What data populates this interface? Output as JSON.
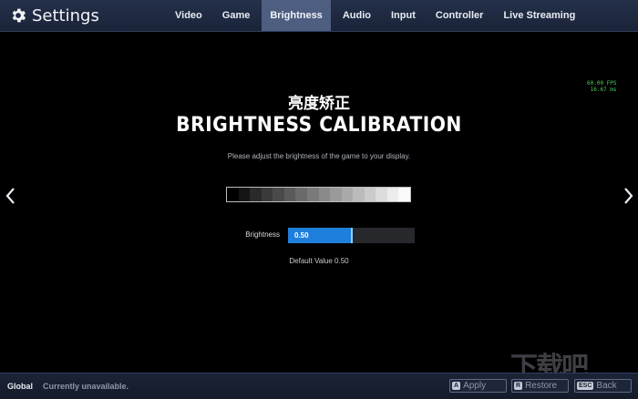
{
  "header": {
    "title": "Settings",
    "tabs": [
      {
        "label": "Video",
        "active": false
      },
      {
        "label": "Game",
        "active": false
      },
      {
        "label": "Brightness",
        "active": true
      },
      {
        "label": "Audio",
        "active": false
      },
      {
        "label": "Input",
        "active": false
      },
      {
        "label": "Controller",
        "active": false
      },
      {
        "label": "Live Streaming",
        "active": false
      }
    ]
  },
  "overlay": {
    "fps": "60.00 FPS",
    "frame_time": "16.67 ms"
  },
  "main": {
    "heading_cn": "亮度矫正",
    "heading_en": "BRIGHTNESS CALIBRATION",
    "instruction": "Please adjust the brightness of the game to your display.",
    "gradient_swatches": [
      "#000000",
      "#151515",
      "#2a2a2a",
      "#3a3a3a",
      "#4a4a4a",
      "#5a5a5a",
      "#6a6a6a",
      "#7a7a7a",
      "#8a8a8a",
      "#9a9a9a",
      "#aaaaaa",
      "#bbbbbb",
      "#cbcbcb",
      "#dcdcdc",
      "#ececec",
      "#fafafa"
    ],
    "brightness": {
      "label": "Brightness",
      "value_text": "0.50",
      "value": 0.5
    },
    "default_value": "Default Value 0.50"
  },
  "watermark": "下载吧",
  "footer": {
    "global_label": "Global",
    "status": "Currently unavailable.",
    "apply": {
      "key": "A",
      "label": "Apply"
    },
    "restore": {
      "key": "R",
      "label": "Restore"
    },
    "back": {
      "key": "ESC",
      "label": "Back"
    }
  },
  "colors": {
    "accent": "#1f7fdc",
    "header_bg": "#1e2840",
    "fps_text": "#4cd15a"
  }
}
